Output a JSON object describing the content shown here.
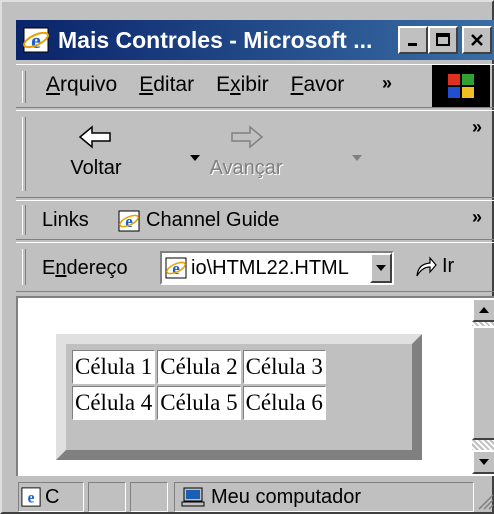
{
  "window": {
    "title": "Mais Controles - Microsoft ...",
    "title_bar_color": "#0a246a"
  },
  "menu": {
    "items": [
      {
        "label": "Arquivo",
        "accel": "A"
      },
      {
        "label": "Editar",
        "accel": "E"
      },
      {
        "label": "Exibir",
        "accel": "x"
      },
      {
        "label": "Favor",
        "accel": "F"
      }
    ],
    "overflow": "»"
  },
  "toolbar": {
    "back_label": "Voltar",
    "forward_label": "Avançar",
    "overflow": "»"
  },
  "links": {
    "label": "Links",
    "channel_guide": "Channel Guide",
    "overflow": "»"
  },
  "address": {
    "label": "Endereço",
    "value": "io\\HTML22.HTML",
    "go_label": "Ir"
  },
  "table": {
    "rows": [
      [
        "Célula 1",
        "Célula 2",
        "Célula 3"
      ],
      [
        "Célula 4",
        "Célula 5",
        "Célula 6"
      ]
    ]
  },
  "status": {
    "left_text": "C",
    "zone_text": "Meu computador"
  }
}
